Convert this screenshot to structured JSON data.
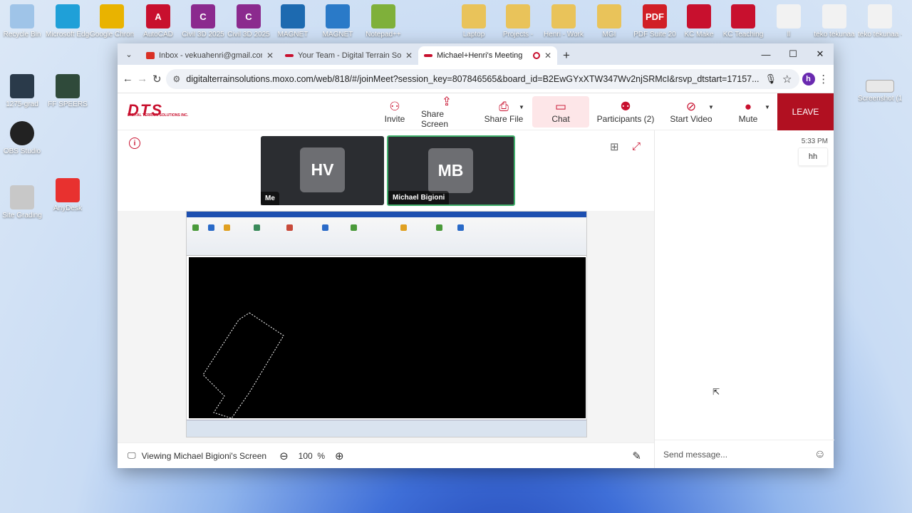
{
  "desktop": {
    "top_icons": [
      {
        "label": "Recycle Bin",
        "icon": "recycle-bin-icon",
        "color": "#9fc4e8"
      },
      {
        "label": "Microsoft Edge",
        "icon": "edge-icon",
        "color": "#1fa0d8"
      },
      {
        "label": "Google Chrome",
        "icon": "chrome-icon",
        "color": "#e9b300"
      },
      {
        "label": "AutoCAD",
        "icon": "autocad-icon",
        "color": "#c8102e",
        "glyph": "A"
      },
      {
        "label": "Civil 3D 2025",
        "icon": "civil3d-icon",
        "color": "#8b2a8e",
        "glyph": "C"
      },
      {
        "label": "Civil 3D 2025",
        "icon": "civil3d-icon",
        "color": "#8b2a8e",
        "glyph": "C"
      },
      {
        "label": "MAGNET",
        "icon": "magnet-icon",
        "color": "#1d6ab0"
      },
      {
        "label": "MAGNET",
        "icon": "magnet-icon",
        "color": "#2a7ac8"
      },
      {
        "label": "Notepad++",
        "icon": "notepad-icon",
        "color": "#7fb03a"
      },
      {
        "label": "Laptop",
        "icon": "folder-icon",
        "color": "#e9c35a"
      },
      {
        "label": "Projects -",
        "icon": "folder-icon",
        "color": "#e9c35a"
      },
      {
        "label": "Henri - Work",
        "icon": "folder-icon",
        "color": "#e9c35a"
      },
      {
        "label": "MGI",
        "icon": "folder-icon",
        "color": "#e9c35a"
      },
      {
        "label": "PDF Suite 20",
        "icon": "pdf-icon",
        "color": "#d11f26",
        "glyph": "PDF"
      },
      {
        "label": "KC Make",
        "icon": "pdf-doc-icon",
        "color": "#c8102e"
      },
      {
        "label": "KC Teaching",
        "icon": "pdf-doc-icon",
        "color": "#c8102e"
      },
      {
        "label": "ll",
        "icon": "document-icon",
        "color": "#f2f2f2"
      },
      {
        "label": "teko tekunaa",
        "icon": "document-icon",
        "color": "#f2f2f2"
      },
      {
        "label": "teko tekunaa - Phasal V...",
        "icon": "document-icon",
        "color": "#f2f2f2"
      }
    ],
    "left_icons": [
      {
        "label": "1275-grad",
        "icon": "thumbnail-icon",
        "color": "#2a3a4a"
      },
      {
        "label": "FF SPEERS",
        "icon": "thumbnail-icon",
        "color": "#2f4a3a"
      },
      {
        "label": "OBS Studio",
        "icon": "obs-icon",
        "color": "#222"
      },
      {
        "label": "Site Grading",
        "icon": "thumbnail-icon",
        "color": "#c8c8c8"
      },
      {
        "label": "AnyDesk",
        "icon": "anydesk-icon",
        "color": "#e8312f"
      }
    ],
    "right_icon": {
      "label": "Screenshot (1)",
      "icon": "thumbnail-icon",
      "color": "#e8e8e8"
    }
  },
  "browser": {
    "tabs": [
      {
        "title": "Inbox - vekuahenri@gmail.com",
        "fav_color": "#d93025",
        "active": false
      },
      {
        "title": "Your Team - Digital Terrain Solu",
        "fav_color": "#c8102e",
        "active": false
      },
      {
        "title": "Michael+Henri's Meeting",
        "fav_color": "#c8102e",
        "active": true
      }
    ],
    "url": "digitalterrainsolutions.moxo.com/web/818/#/joinMeet?session_key=807846565&board_id=B2EwGYxXTW347Wv2njSRMcI&rsvp_dtstart=17157..."
  },
  "meeting": {
    "logo_text": "DTS",
    "logo_sub": "DIGITAL TERRAIN SOLUTIONS INC.",
    "toolbar": {
      "invite": "Invite",
      "share_screen": "Share Screen",
      "share_file": "Share File",
      "chat": "Chat",
      "participants": "Participants (2)",
      "start_video": "Start Video",
      "mute": "Mute",
      "leave": "LEAVE"
    },
    "tiles": [
      {
        "initials": "HV",
        "name": "Me"
      },
      {
        "initials": "MB",
        "name": "Michael Bigioni"
      }
    ],
    "viewing": "Viewing Michael Bigioni's Screen",
    "zoom": "100",
    "zoom_unit": "%"
  },
  "chat": {
    "time": "5:33 PM",
    "message": "hh",
    "placeholder": "Send message..."
  }
}
